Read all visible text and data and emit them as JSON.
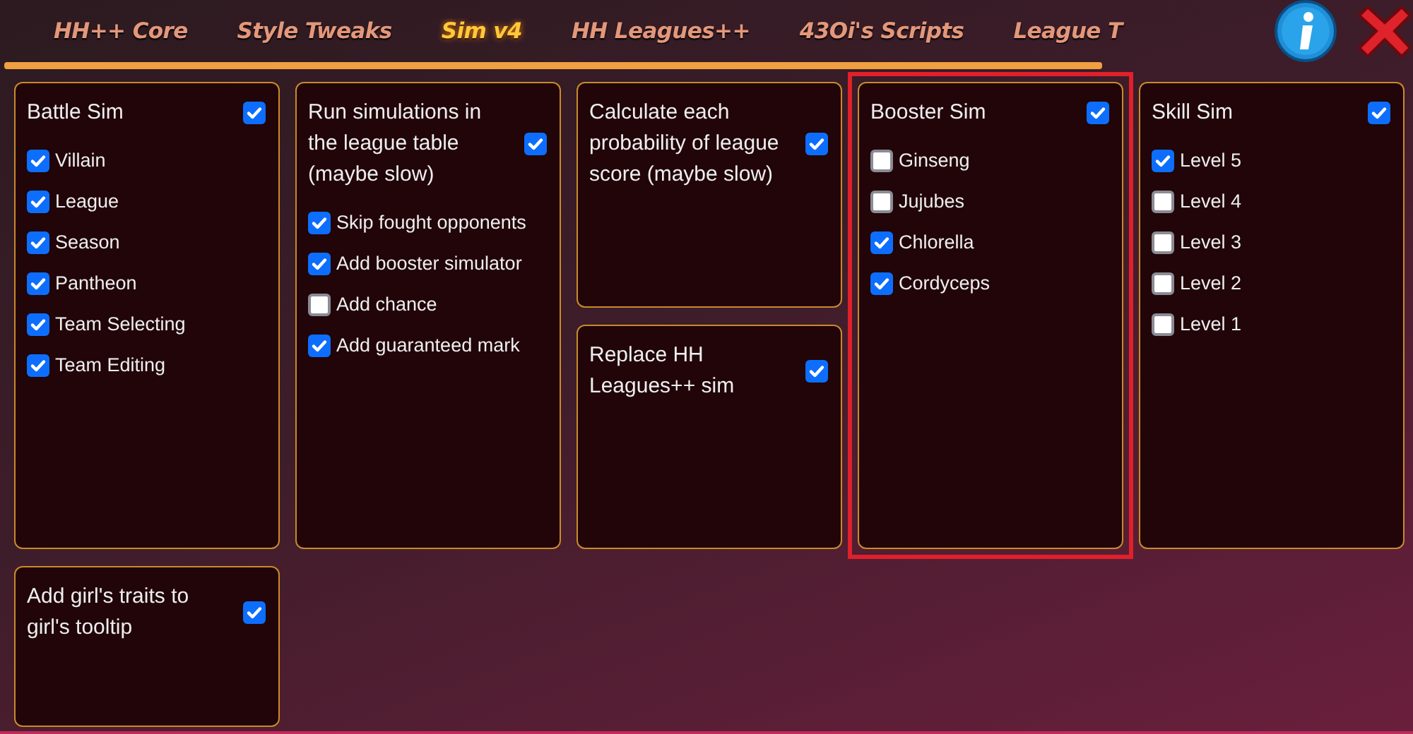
{
  "tabs": [
    {
      "label": "HH++ Core",
      "selected": false
    },
    {
      "label": "Style Tweaks",
      "selected": false
    },
    {
      "label": "Sim v4",
      "selected": true
    },
    {
      "label": "HH Leagues++",
      "selected": false
    },
    {
      "label": "43Oi's Scripts",
      "selected": false
    },
    {
      "label": "League T",
      "selected": false
    }
  ],
  "rows": [
    {
      "stacks": [
        {
          "cards": [
            {
              "title": "Battle Sim",
              "checked": true,
              "highlighted": false,
              "options": [
                {
                  "label": "Villain",
                  "checked": true
                },
                {
                  "label": "League",
                  "checked": true
                },
                {
                  "label": "Season",
                  "checked": true
                },
                {
                  "label": "Pantheon",
                  "checked": true
                },
                {
                  "label": "Team Selecting",
                  "checked": true
                },
                {
                  "label": "Team Editing",
                  "checked": true
                }
              ]
            }
          ]
        },
        {
          "cards": [
            {
              "title": "Run simulations in the league table (maybe slow)",
              "checked": true,
              "highlighted": false,
              "options": [
                {
                  "label": "Skip fought opponents",
                  "checked": true
                },
                {
                  "label": "Add booster simulator",
                  "checked": true
                },
                {
                  "label": "Add chance",
                  "checked": false
                },
                {
                  "label": "Add guaranteed mark",
                  "checked": true
                }
              ]
            }
          ]
        },
        {
          "cards": [
            {
              "title": "Calculate each probability of league score (maybe slow)",
              "checked": true,
              "highlighted": false
            },
            {
              "title": "Replace HH Leagues++ sim",
              "checked": true,
              "highlighted": false
            }
          ]
        },
        {
          "cards": [
            {
              "title": "Booster Sim",
              "checked": true,
              "highlighted": true,
              "options": [
                {
                  "label": "Ginseng",
                  "checked": false
                },
                {
                  "label": "Jujubes",
                  "checked": false
                },
                {
                  "label": "Chlorella",
                  "checked": true
                },
                {
                  "label": "Cordyceps",
                  "checked": true
                }
              ]
            }
          ]
        },
        {
          "cards": [
            {
              "title": "Skill Sim",
              "checked": true,
              "highlighted": false,
              "options": [
                {
                  "label": "Level 5",
                  "checked": true
                },
                {
                  "label": "Level 4",
                  "checked": false
                },
                {
                  "label": "Level 3",
                  "checked": false
                },
                {
                  "label": "Level 2",
                  "checked": false
                },
                {
                  "label": "Level 1",
                  "checked": false
                }
              ]
            }
          ]
        }
      ]
    },
    {
      "stacks": [
        {
          "cards": [
            {
              "title": "Add girl's traits to girl's tooltip",
              "checked": true,
              "highlighted": false
            }
          ]
        }
      ]
    }
  ]
}
